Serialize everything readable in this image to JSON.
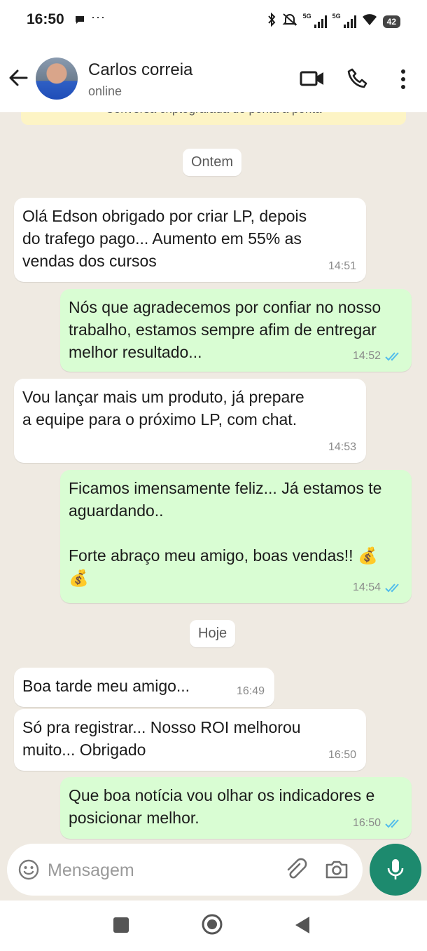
{
  "status_bar": {
    "time": "16:50",
    "more": "···",
    "net1": "5G",
    "net2": "5G",
    "battery": "42"
  },
  "header": {
    "contact_name": "Carlos correia",
    "contact_status": "online"
  },
  "banner": {
    "text": "Conversa criptografada de ponta a ponta"
  },
  "chips": {
    "yesterday": "Ontem",
    "today": "Hoje"
  },
  "messages": [
    {
      "dir": "in",
      "text": "Olá Edson obrigado por criar LP, depois\ndo trafego pago... Aumento em 55% as\nvendas dos cursos",
      "time": "14:51"
    },
    {
      "dir": "out",
      "text": "Nós que agradecemos por confiar no nosso\ntrabalho, estamos sempre afim de entregar\nmelhor resultado...",
      "time": "14:52"
    },
    {
      "dir": "in",
      "text": "Vou lançar mais um produto, já prepare\na equipe para o próximo LP, com chat.",
      "time": "14:53"
    },
    {
      "dir": "out",
      "text": "Ficamos imensamente feliz... Já estamos te\naguardando..\n\nForte abraço meu amigo, boas vendas!! 💰\n💰",
      "time": "14:54"
    },
    {
      "dir": "in",
      "text": "Boa tarde meu amigo...",
      "time": "16:49"
    },
    {
      "dir": "in",
      "text": "Só pra registrar... Nosso ROI melhorou\nmuito... Obrigado",
      "time": "16:50"
    },
    {
      "dir": "out",
      "text": "Que boa notícia vou olhar os indicadores e\nposicionar melhor.",
      "time": "16:50"
    }
  ],
  "input": {
    "placeholder": "Mensagem"
  },
  "colors": {
    "outgoing_bubble": "#d9fdd3",
    "incoming_bubble": "#ffffff",
    "chat_background": "#efeae2",
    "read_ticks": "#53bdeb",
    "mic_button": "#1d8a6e"
  },
  "icons": {
    "back": "arrow-left-icon",
    "video": "video-camera-icon",
    "call": "phone-icon",
    "menu": "more-vert-icon",
    "emoji": "smiley-icon",
    "attach": "paperclip-icon",
    "camera": "camera-icon",
    "mic": "microphone-icon"
  }
}
